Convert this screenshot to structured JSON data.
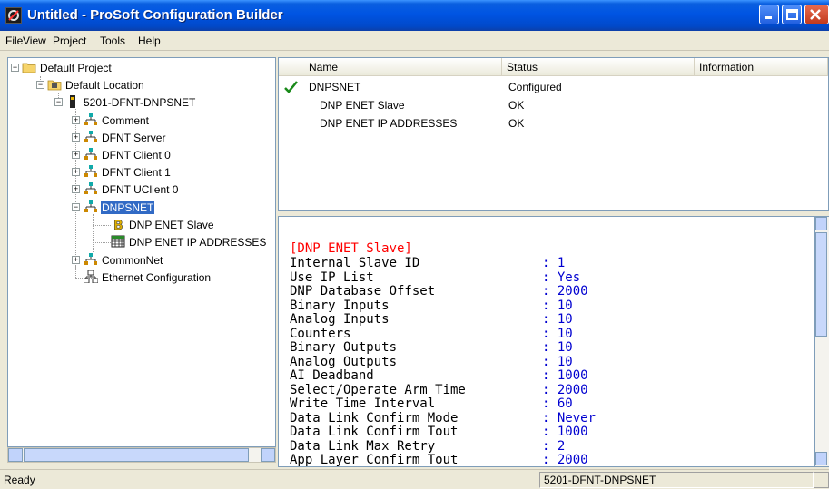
{
  "window": {
    "title": "Untitled - ProSoft Configuration Builder"
  },
  "menu": [
    "File",
    "View",
    "Project",
    "Tools",
    "Help"
  ],
  "tree": {
    "items": [
      {
        "label": "Default Project"
      },
      {
        "label": "Default Location"
      },
      {
        "label": "5201-DFNT-DNPSNET"
      },
      {
        "label": "Comment"
      },
      {
        "label": "DFNT Server"
      },
      {
        "label": "DFNT Client 0"
      },
      {
        "label": "DFNT Client 1"
      },
      {
        "label": "DFNT UClient 0"
      },
      {
        "label": "DNPSNET",
        "selected": true
      },
      {
        "label": "DNP ENET Slave"
      },
      {
        "label": "DNP ENET IP ADDRESSES"
      },
      {
        "label": "CommonNet"
      },
      {
        "label": "Ethernet Configuration"
      }
    ]
  },
  "list": {
    "columns": [
      "Name",
      "Status",
      "Information"
    ],
    "rows": [
      {
        "name": "DNPSNET",
        "status": "Configured",
        "check": true
      },
      {
        "name": "DNP ENET Slave",
        "status": "OK"
      },
      {
        "name": "DNP ENET IP ADDRESSES",
        "status": "OK"
      }
    ]
  },
  "detail": {
    "section": "[DNP ENET Slave]",
    "rows": [
      {
        "key": "Internal Slave ID",
        "value": "1"
      },
      {
        "key": "Use IP List",
        "value": "Yes"
      },
      {
        "key": "DNP Database Offset",
        "value": "2000"
      },
      {
        "key": "Binary Inputs",
        "value": "10"
      },
      {
        "key": "Analog Inputs",
        "value": "10"
      },
      {
        "key": "Counters",
        "value": "10"
      },
      {
        "key": "Binary Outputs",
        "value": "10"
      },
      {
        "key": "Analog Outputs",
        "value": "10"
      },
      {
        "key": "AI Deadband",
        "value": "1000"
      },
      {
        "key": "Select/Operate Arm Time",
        "value": "2000"
      },
      {
        "key": "Write Time Interval",
        "value": "60"
      },
      {
        "key": "Data Link Confirm Mode",
        "value": "Never"
      },
      {
        "key": "Data Link Confirm Tout",
        "value": "1000"
      },
      {
        "key": "Data Link Max Retry",
        "value": "2"
      },
      {
        "key": "App Layer Confirm Tout",
        "value": "2000"
      }
    ]
  },
  "status": {
    "text": "Ready",
    "module": "5201-DFNT-DNPSNET"
  },
  "colors": {
    "title_bar": "#0054e3",
    "selection": "#316ac5",
    "section_header": "#ff0000",
    "value_text": "#0000d0",
    "check": "#1a8a1a"
  }
}
